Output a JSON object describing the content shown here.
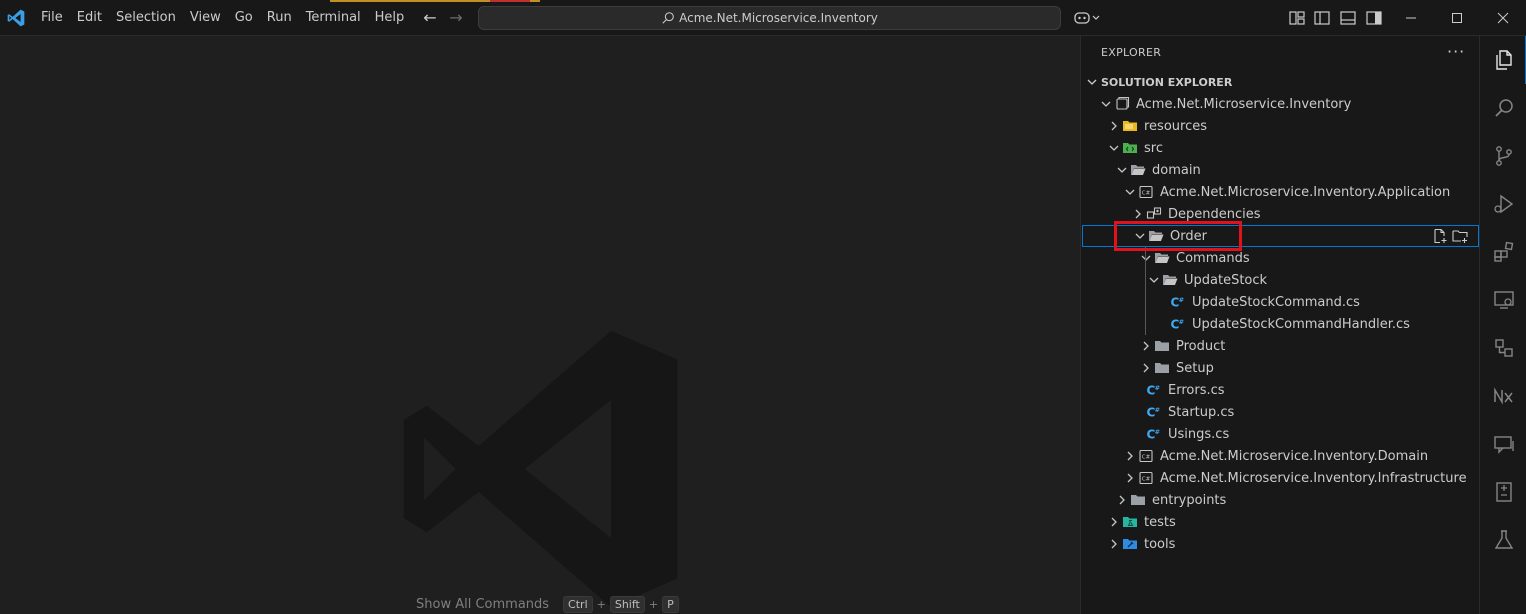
{
  "titlebar": {
    "menu": [
      "File",
      "Edit",
      "Selection",
      "View",
      "Go",
      "Run",
      "Terminal",
      "Help"
    ],
    "search_text": "Acme.Net.Microservice.Inventory"
  },
  "editor": {
    "hint_label": "Show All Commands",
    "hint_keys": [
      "Ctrl",
      "Shift",
      "P"
    ]
  },
  "sidebar": {
    "title": "EXPLORER",
    "section": "SOLUTION EXPLORER",
    "tree": [
      {
        "label": "Acme.Net.Microservice.Inventory",
        "icon": "solution-icon",
        "expanded": true
      },
      {
        "label": "resources",
        "icon": "folder-yellow-icon",
        "expanded": false
      },
      {
        "label": "src",
        "icon": "folder-src-icon",
        "expanded": true
      },
      {
        "label": "domain",
        "icon": "folder-open-icon",
        "expanded": true
      },
      {
        "label": "Acme.Net.Microservice.Inventory.Application",
        "icon": "csproj-icon",
        "expanded": true
      },
      {
        "label": "Dependencies",
        "icon": "dependencies-icon",
        "expanded": false
      },
      {
        "label": "Order",
        "icon": "folder-open-icon",
        "expanded": true,
        "selected": true
      },
      {
        "label": "Commands",
        "icon": "folder-open-icon",
        "expanded": true
      },
      {
        "label": "UpdateStock",
        "icon": "folder-open-icon",
        "expanded": true
      },
      {
        "label": "UpdateStockCommand.cs",
        "icon": "csharp-file-icon"
      },
      {
        "label": "UpdateStockCommandHandler.cs",
        "icon": "csharp-file-icon"
      },
      {
        "label": "Product",
        "icon": "folder-icon",
        "expanded": false
      },
      {
        "label": "Setup",
        "icon": "folder-icon",
        "expanded": false
      },
      {
        "label": "Errors.cs",
        "icon": "csharp-file-icon"
      },
      {
        "label": "Startup.cs",
        "icon": "csharp-file-icon"
      },
      {
        "label": "Usings.cs",
        "icon": "csharp-file-icon"
      },
      {
        "label": "Acme.Net.Microservice.Inventory.Domain",
        "icon": "csproj-icon",
        "expanded": false
      },
      {
        "label": "Acme.Net.Microservice.Inventory.Infrastructure",
        "icon": "csproj-icon",
        "expanded": false
      },
      {
        "label": "entrypoints",
        "icon": "folder-icon",
        "expanded": false
      },
      {
        "label": "tests",
        "icon": "folder-tests-icon",
        "expanded": false
      },
      {
        "label": "tools",
        "icon": "folder-tools-icon",
        "expanded": false
      }
    ]
  },
  "activity_bar": [
    "explorer-icon",
    "search-icon",
    "source-control-icon",
    "run-debug-icon",
    "extensions-icon",
    "remote-explorer-icon",
    "containers-icon",
    "nx-icon",
    "chat-icon",
    "notes-icon",
    "testing-icon"
  ],
  "colors": {
    "accent": "#0078d4",
    "highlight": "#e0121a",
    "csharp": "#3fa9f5",
    "folder": "#c5c5c5"
  }
}
